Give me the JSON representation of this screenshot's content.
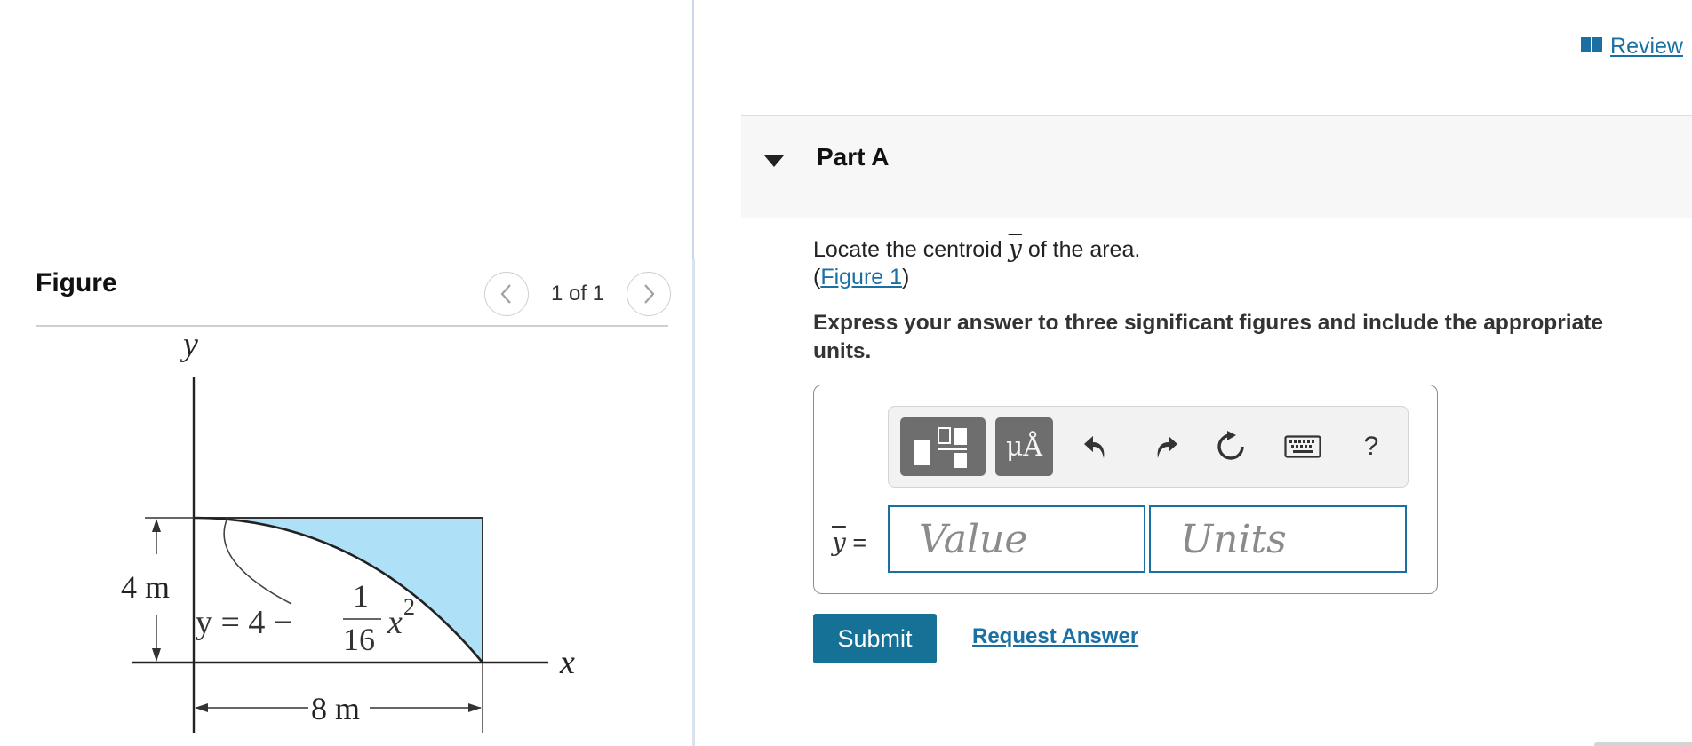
{
  "header": {
    "review_label": "Review"
  },
  "figure_panel": {
    "title": "Figure",
    "pager": "1 of 1",
    "prev_icon": "chevron-left-icon",
    "next_icon": "chevron-right-icon",
    "diagram": {
      "y_axis_label": "y",
      "x_axis_label": "x",
      "height_dim": "4 m",
      "width_dim": "8 m",
      "curve_eq_lhs": "y = 4 −",
      "curve_eq_num": "1",
      "curve_eq_den": "16",
      "curve_eq_var": "x",
      "curve_eq_exp": "2",
      "fill_color": "#aee0f8"
    }
  },
  "part": {
    "title": "Part A",
    "question_prefix": "Locate the centroid",
    "question_symbol": "y",
    "question_suffix": "of the area.",
    "figure_ref_open": "(",
    "figure_ref": "Figure 1",
    "figure_ref_close": ")",
    "instruction": "Express your answer to three significant figures and include the appropriate units."
  },
  "answer": {
    "symbol": "y",
    "equals": "=",
    "value_placeholder": "Value",
    "units_placeholder": "Units",
    "toolbar": {
      "templates_icon": "templates-icon",
      "units_label": "μÅ",
      "undo_icon": "undo-icon",
      "redo_icon": "redo-icon",
      "reset_icon": "reset-icon",
      "keyboard_icon": "keyboard-icon",
      "help_label": "?"
    }
  },
  "actions": {
    "submit_label": "Submit",
    "request_label": "Request Answer"
  },
  "colors": {
    "link": "#1a6fa3",
    "submit_bg": "#157196",
    "input_border": "#1a6fa3",
    "toolbar_button": "#6e6e6e"
  }
}
